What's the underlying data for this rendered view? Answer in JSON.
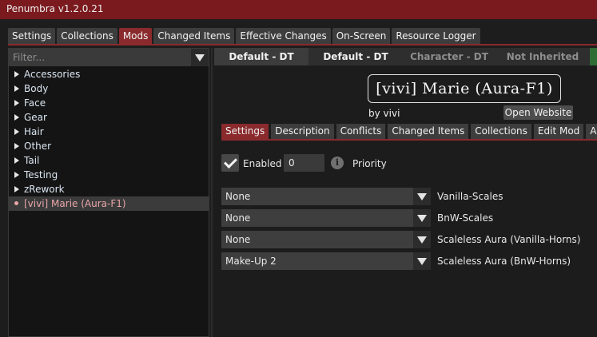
{
  "window": {
    "title": "Penumbra v1.2.0.21"
  },
  "main_tabs": [
    {
      "label": "Settings"
    },
    {
      "label": "Collections"
    },
    {
      "label": "Mods",
      "active": true
    },
    {
      "label": "Changed Items"
    },
    {
      "label": "Effective Changes"
    },
    {
      "label": "On-Screen"
    },
    {
      "label": "Resource Logger"
    }
  ],
  "filter": {
    "placeholder": "Filter..."
  },
  "mod_tree": [
    {
      "label": "Accessories"
    },
    {
      "label": "Body"
    },
    {
      "label": "Face"
    },
    {
      "label": "Gear"
    },
    {
      "label": "Hair"
    },
    {
      "label": "Other"
    },
    {
      "label": "Tail"
    },
    {
      "label": "Testing"
    },
    {
      "label": "zRework"
    },
    {
      "label": "[vivi] Marie (Aura-F1)",
      "selected": true
    }
  ],
  "header_bar": {
    "default_dt_1": "Default - DT",
    "default_dt_2": "Default - DT",
    "character_dt": "Character - DT",
    "not_inherited": "Not Inherited"
  },
  "mod": {
    "name": "[vivi] Marie (Aura-F1)",
    "author_prefix": "by",
    "author": "vivi",
    "website_button": "Open Website"
  },
  "mod_tabs": [
    {
      "label": "Settings",
      "active": true
    },
    {
      "label": "Description"
    },
    {
      "label": "Conflicts"
    },
    {
      "label": "Changed Items"
    },
    {
      "label": "Collections"
    },
    {
      "label": "Edit Mod"
    },
    {
      "label": "Advan"
    }
  ],
  "settings": {
    "enabled_label": "Enabled",
    "enabled": true,
    "priority_value": "0",
    "priority_label": "Priority",
    "info_glyph": "i"
  },
  "options": [
    {
      "value": "None",
      "label": "Vanilla-Scales"
    },
    {
      "value": "None",
      "label": "BnW-Scales"
    },
    {
      "value": "None",
      "label": "Scaleless Aura (Vanilla-Horns)"
    },
    {
      "value": "Make-Up 2",
      "label": "Scaleless Aura (BnW-Horns)"
    }
  ],
  "colors": {
    "accent": "#8a2a2d",
    "selected_text": "#e9a6a9"
  },
  "icons": {
    "folder_expand": "triangle-right-icon",
    "dropdown": "chevron-down-icon",
    "checkbox": "check-icon",
    "info": "info-icon",
    "selected_marker": "dot-icon"
  }
}
